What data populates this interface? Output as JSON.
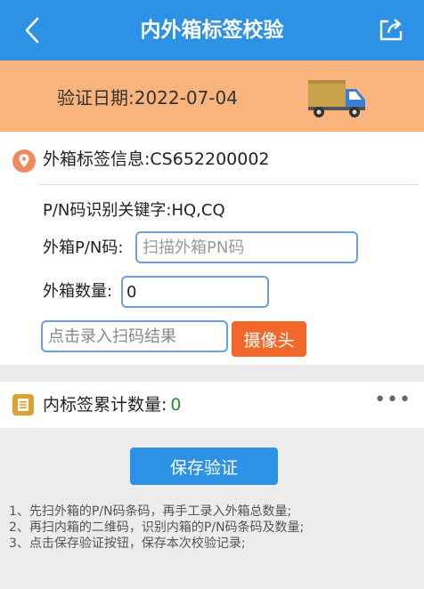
{
  "header": {
    "title": "内外箱标签校验",
    "back_icon": "chevron-left-icon",
    "share_icon": "share-icon",
    "color": "#2d92e6"
  },
  "banner": {
    "date_text": "验证日期:2022-07-04",
    "truck_icon": "delivery-truck-icon",
    "color": "#f9b37d"
  },
  "outer_box": {
    "info_label": "外箱标签信息:CS652200002",
    "keyword_label": "P/N码识别关键字:HQ,CQ",
    "pn_label": "外箱P/N码:",
    "pn_placeholder": "扫描外箱PN码",
    "qty_label": "外箱数量:",
    "qty_value": "0",
    "scan_placeholder": "点击录入扫码结果",
    "camera_button": "摄像头"
  },
  "inner_box": {
    "label": "内标签累计数量:",
    "count": "0",
    "more_icon": "more-dots-icon",
    "more_text": "•••"
  },
  "save_button": "保存验证",
  "tips": [
    "1、先扫外箱的P/N码条码，再手工录入外箱总数量;",
    "2、再扫内箱的二维码，识别内箱的P/N码条码及数量;",
    "3、点击保存验证按钮，保存本次校验记录;"
  ],
  "colors": {
    "accent": "#2d92e6",
    "camera_button": "#f1682a",
    "count": "#2a8a2a"
  }
}
